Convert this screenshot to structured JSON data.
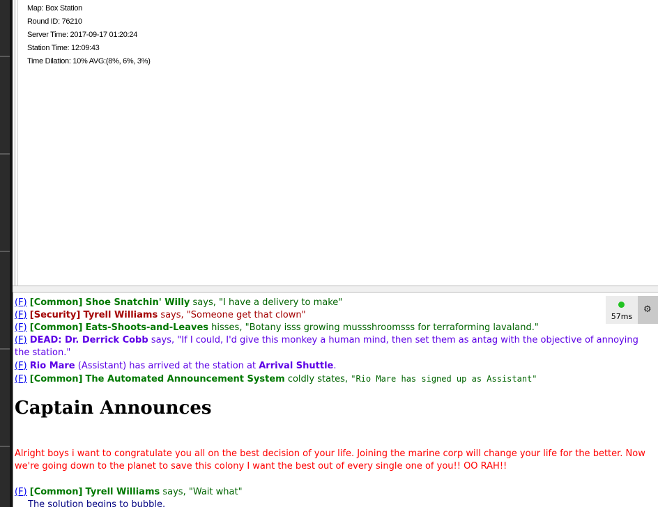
{
  "status": {
    "map": "Map: Box Station",
    "round_id": "Round ID: 76210",
    "server_time": "Server Time: 2017-09-17 01:20:24",
    "station_time": "Station Time: 12:09:43",
    "time_dilation": "Time Dilation: 10% AVG:(8%, 6%, 3%)"
  },
  "ping": {
    "value": "57ms",
    "status_color": "#22c322",
    "settings_icon": "gear-icon"
  },
  "chat": {
    "follow_label": "(F)",
    "messages": [
      {
        "channel": "[Common]",
        "speaker": "Shoe Snatchin' Willy",
        "verb": " says, ",
        "text": "\"I have a delivery to make\""
      },
      {
        "channel": "[Security]",
        "speaker": "Tyrell Williams",
        "verb": " says, ",
        "text": "\"Someone get that clown\""
      },
      {
        "channel": "[Common]",
        "speaker": "Eats-Shoots-and-Leaves",
        "verb": " hisses, ",
        "text": "\"Botany isss growing mussshroomsss for terraforming lavaland.\""
      },
      {
        "channel": "",
        "speaker": "DEAD: Dr. Derrick Cobb",
        "verb": " says, ",
        "text": "\"If I could, I'd give this monkey a human mind, then set them as antag with the objective of annoying the station.\""
      },
      {
        "channel": "",
        "speaker": "Rio Mare",
        "verb": " (Assistant) has arrived at the station at ",
        "text": "Arrival Shuttle",
        "end": "."
      },
      {
        "channel": "[Common]",
        "speaker": "The Automated Announcement System",
        "verb": " coldly states, ",
        "text": "\"Rio Mare has signed up as Assistant\""
      },
      {
        "channel": "[Common]",
        "speaker": "Tyrell Williams",
        "verb": " says, ",
        "text": "\"Wait what\""
      }
    ],
    "announcement": {
      "title": "Captain Announces",
      "body": "Alright boys i want to congratulate you all on the best decision of your life. Joining the marine corp will change your life for the better. Now we're going down to the planet to save this colony I want the best out of every single one of you!! OO RAH!!"
    },
    "notice": "The solution begins to bubble."
  }
}
